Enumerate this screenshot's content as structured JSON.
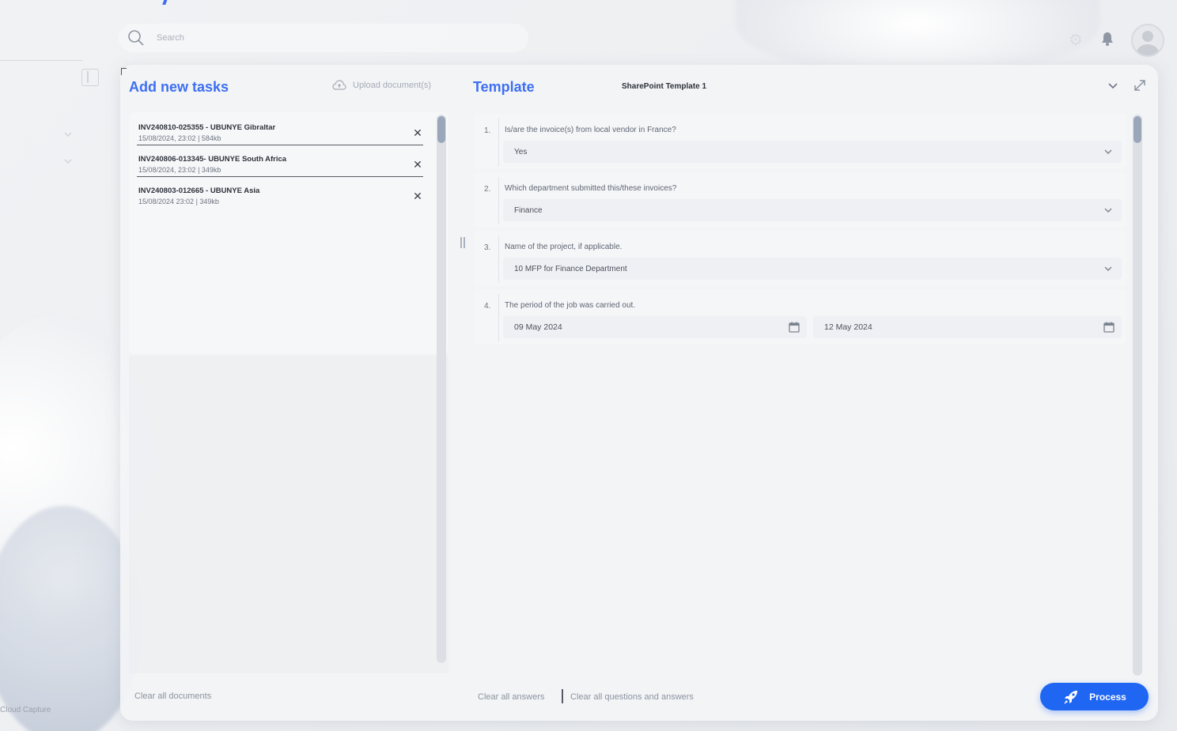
{
  "search": {
    "placeholder": "Search"
  },
  "sidebar": {
    "footer": "Cloud Capture"
  },
  "tasks": {
    "title": "Add new tasks",
    "upload_label": "Upload document(s)",
    "documents": [
      {
        "name": "INV240810-025355 - UBUNYE Gibraltar",
        "meta": "15/08/2024, 23:02 | 584kb"
      },
      {
        "name": "INV240806-013345- UBUNYE South Africa",
        "meta": "15/08/2024, 23:02 | 349kb"
      },
      {
        "name": "INV240803-012665 - UBUNYE Asia",
        "meta": "15/08/2024 23:02 | 349kb"
      }
    ],
    "clear_label": "Clear all documents"
  },
  "template": {
    "title": "Template",
    "selected": "SharePoint Template 1",
    "questions": [
      {
        "num": "1.",
        "text": "Is/are the invoice(s) from local vendor in France?",
        "answer": "Yes"
      },
      {
        "num": "2.",
        "text": "Which department submitted this/these invoices?",
        "answer": "Finance"
      },
      {
        "num": "3.",
        "text": "Name of the project, if applicable.",
        "answer": "10 MFP for Finance Department"
      },
      {
        "num": "4.",
        "text": "The period of the job was carried out.",
        "date_from": "09 May 2024",
        "date_to": "12 May 2024"
      }
    ],
    "clear_answers": "Clear all answers",
    "clear_all": "Clear all questions and answers",
    "process_label": "Process"
  },
  "colors": {
    "accent": "#3d6ff2",
    "button": "#1f66f3"
  }
}
